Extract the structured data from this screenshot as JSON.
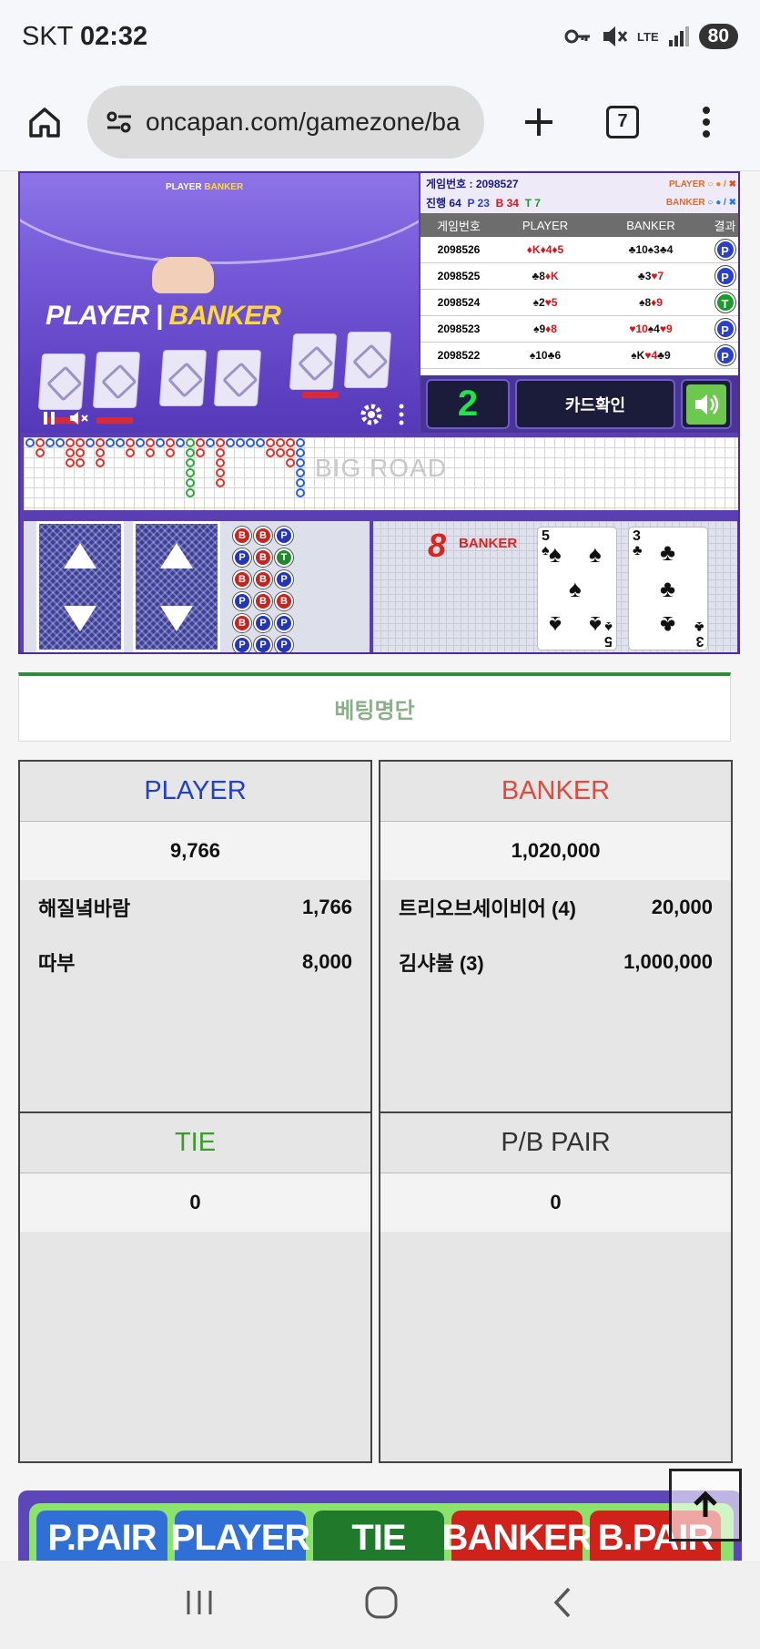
{
  "status_bar": {
    "carrier": "SKT",
    "time": "02:32",
    "network": "LTE",
    "battery": "80"
  },
  "browser": {
    "url": "oncapan.com/gamezone/ba",
    "tab_count": "7"
  },
  "video": {
    "player_label": "PLAYER",
    "banker_label": "BANKER"
  },
  "game_panel": {
    "game_no_label": "게임번호 : 2098527",
    "progress_label": "진행 64",
    "p_count": "P 23",
    "b_count": "B 34",
    "t_count": "T 7",
    "legend_player": "PLAYER",
    "legend_banker": "BANKER",
    "columns": [
      "게임번호",
      "PLAYER",
      "BANKER",
      "결과"
    ],
    "rows": [
      {
        "no": "2098526",
        "player": [
          {
            "s": "♦K",
            "c": "red"
          },
          {
            "s": "♦4",
            "c": "red"
          },
          {
            "s": "♦5",
            "c": "red"
          }
        ],
        "banker": [
          {
            "s": "♣10",
            "c": "blk"
          },
          {
            "s": "♠3",
            "c": "blk"
          },
          {
            "s": "♣4",
            "c": "blk"
          }
        ],
        "result": "P"
      },
      {
        "no": "2098525",
        "player": [
          {
            "s": "♣8",
            "c": "blk"
          },
          {
            "s": "♦K",
            "c": "red"
          }
        ],
        "banker": [
          {
            "s": "♣3",
            "c": "blk"
          },
          {
            "s": "♥7",
            "c": "red"
          }
        ],
        "result": "P"
      },
      {
        "no": "2098524",
        "player": [
          {
            "s": "♠2",
            "c": "blk"
          },
          {
            "s": "♥5",
            "c": "red"
          }
        ],
        "banker": [
          {
            "s": "♠8",
            "c": "blk"
          },
          {
            "s": "♦9",
            "c": "red"
          }
        ],
        "result": "T"
      },
      {
        "no": "2098523",
        "player": [
          {
            "s": "♠9",
            "c": "blk"
          },
          {
            "s": "♦8",
            "c": "red"
          }
        ],
        "banker": [
          {
            "s": "♥10",
            "c": "red"
          },
          {
            "s": "♠4",
            "c": "blk"
          },
          {
            "s": "♥9",
            "c": "red"
          }
        ],
        "result": "P"
      },
      {
        "no": "2098522",
        "player": [
          {
            "s": "♠10",
            "c": "blk"
          },
          {
            "s": "♣6",
            "c": "blk"
          }
        ],
        "banker": [
          {
            "s": "♠K",
            "c": "blk"
          },
          {
            "s": "♥4",
            "c": "red"
          },
          {
            "s": "♣9",
            "c": "blk"
          }
        ],
        "result": "P"
      }
    ],
    "countdown": "2",
    "card_check_label": "카드확인"
  },
  "big_road": {
    "watermark": "BIG ROAD"
  },
  "current_hand": {
    "banker_score": "8",
    "banker_label": "BANKER",
    "banker_cards": [
      {
        "rank": "5",
        "suit": "♠"
      },
      {
        "rank": "3",
        "suit": "♣"
      }
    ]
  },
  "betting": {
    "header": "베팅명단",
    "boxes": [
      {
        "title": "PLAYER",
        "color": "#1f3fd1",
        "total": "9,766",
        "entries": [
          {
            "name": "해질녘바람",
            "amount": "1,766"
          },
          {
            "name": "따부",
            "amount": "8,000"
          }
        ]
      },
      {
        "title": "BANKER",
        "color": "#e04a3a",
        "total": "1,020,000",
        "entries": [
          {
            "name": "트리오브세이비어 (4)",
            "amount": "20,000"
          },
          {
            "name": "김샤불 (3)",
            "amount": "1,000,000"
          }
        ]
      },
      {
        "title": "TIE",
        "color": "#3a9c2a",
        "total": "0",
        "entries": []
      },
      {
        "title": "P/B PAIR",
        "color": "#333333",
        "total": "0",
        "entries": []
      }
    ]
  },
  "bet_buttons": [
    {
      "label": "P.PAIR",
      "color": "#2f6fd6"
    },
    {
      "label": "PLAYER",
      "color": "#2f6fd6"
    },
    {
      "label": "TIE",
      "color": "#1f7a2c"
    },
    {
      "label": "BANKER",
      "color": "#d1211b"
    },
    {
      "label": "B.PAIR",
      "color": "#d1211b"
    }
  ]
}
